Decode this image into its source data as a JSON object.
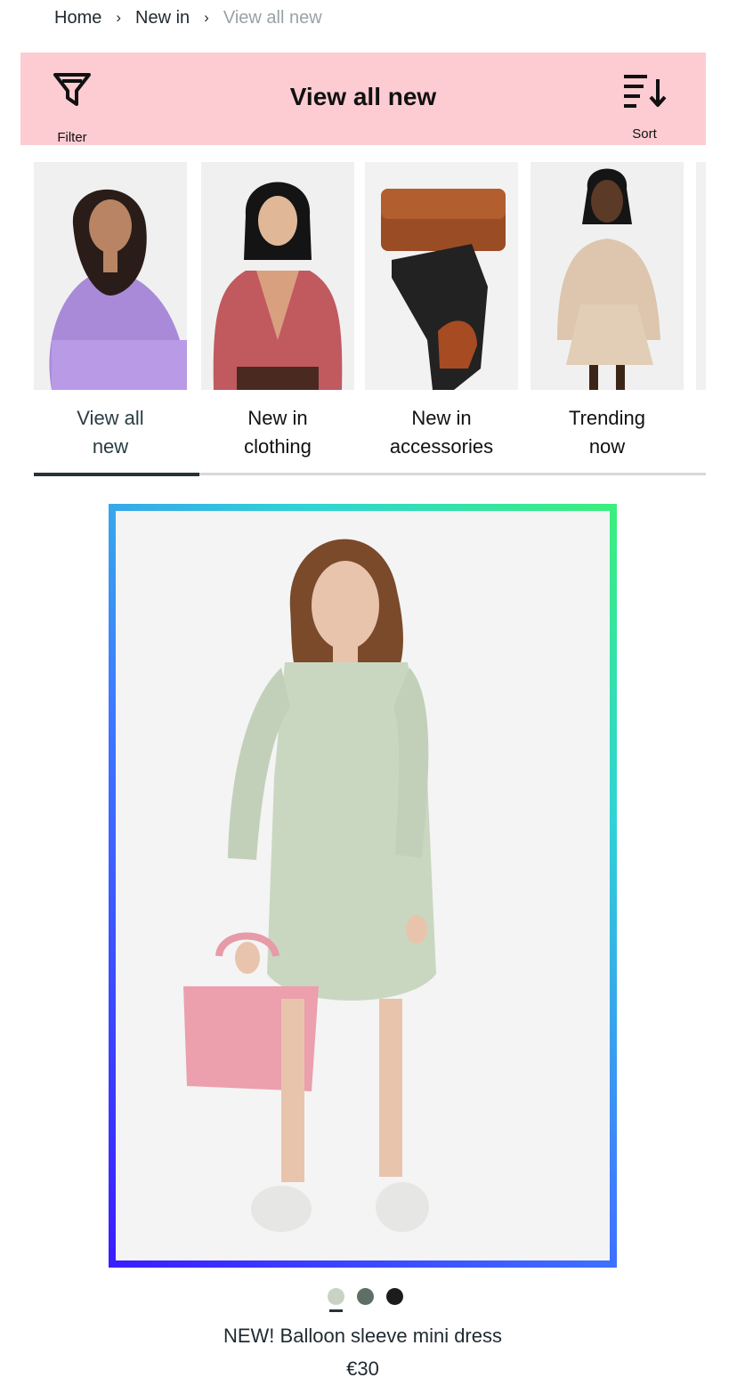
{
  "breadcrumb": {
    "home": "Home",
    "new_in": "New in",
    "current": "View all new",
    "separator": "›"
  },
  "header": {
    "title": "View all new",
    "filter_label": "Filter",
    "sort_label": "Sort",
    "background": "#fdccd3",
    "icons": {
      "filter": "filter-funnel-icon",
      "sort": "sort-arrow-icon"
    }
  },
  "categories": [
    {
      "label_line1": "View all",
      "label_line2": "new",
      "active": true
    },
    {
      "label_line1": "New in",
      "label_line2": "clothing",
      "active": false
    },
    {
      "label_line1": "New in",
      "label_line2": "accessories",
      "active": false
    },
    {
      "label_line1": "Trending",
      "label_line2": "now",
      "active": false
    }
  ],
  "product": {
    "name": "NEW! Balloon sleeve mini dress",
    "price": "€30",
    "swatches": [
      {
        "color": "#c9d3c3",
        "selected": true
      },
      {
        "color": "#5e6f66",
        "selected": false
      },
      {
        "color": "#1c1c1c",
        "selected": false
      }
    ]
  },
  "colors": {
    "text": "#1f2a30",
    "muted": "#9aa2a6",
    "accent_gradient_start": "#3a1cff",
    "accent_gradient_end": "#3af07a"
  }
}
